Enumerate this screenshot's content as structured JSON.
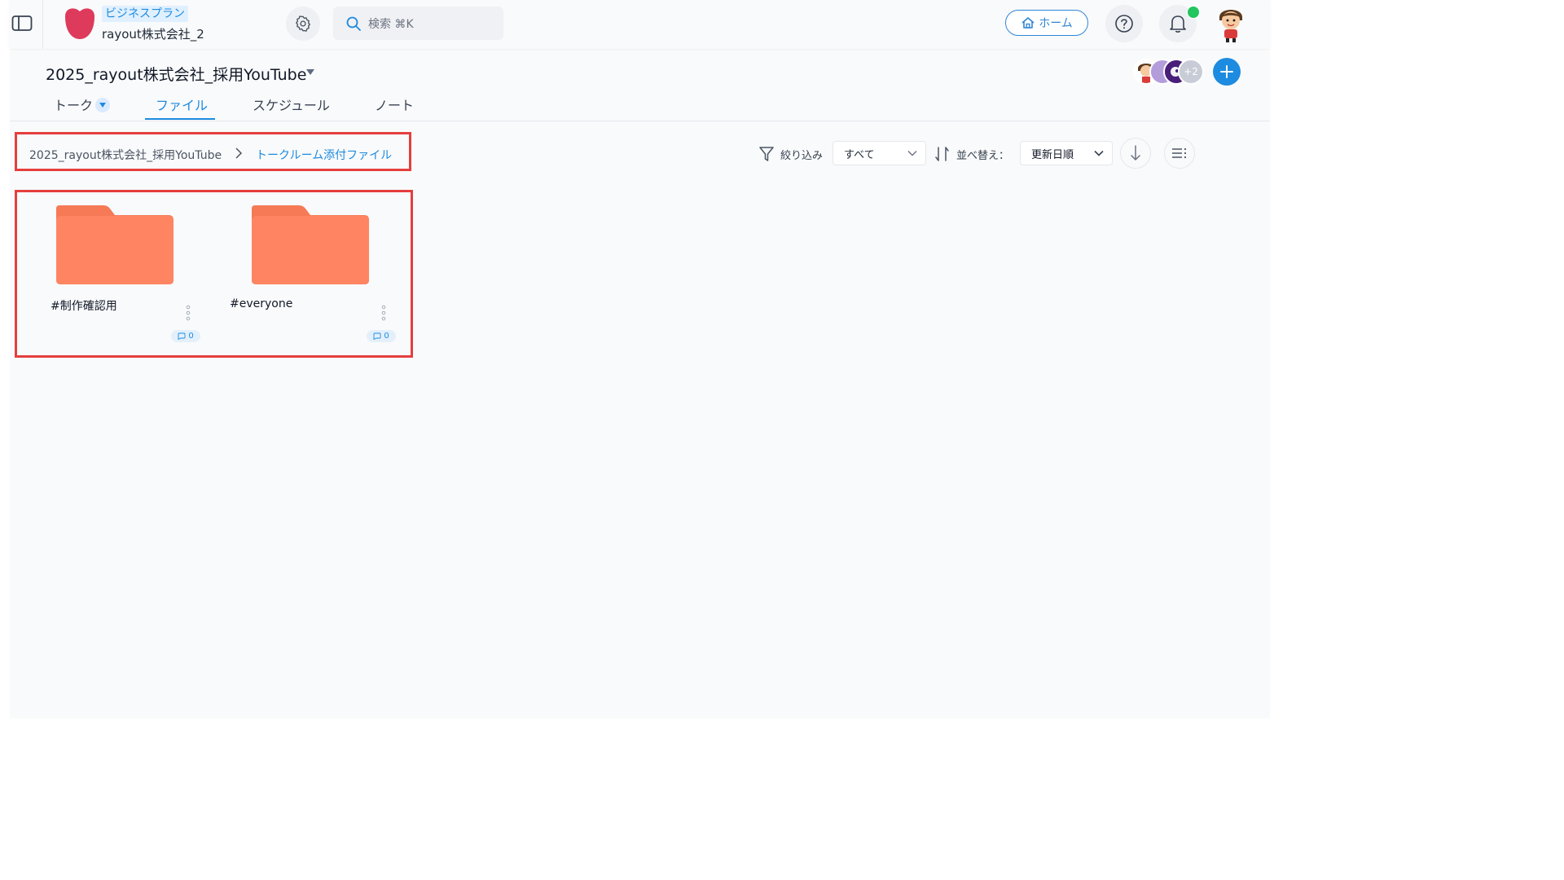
{
  "header": {
    "plan_badge": "ビジネスプラン",
    "org_name": "rayout株式会社_2",
    "search_placeholder": "検索 ⌘K",
    "home_label": "ホーム"
  },
  "room": {
    "title": "2025_rayout株式会社_採用YouTube",
    "tabs": [
      {
        "label": "トーク"
      },
      {
        "label": "ファイル",
        "active": true
      },
      {
        "label": "スケジュール"
      },
      {
        "label": "ノート"
      }
    ],
    "members_more": "+2"
  },
  "breadcrumb": {
    "root": "2025_rayout株式会社_採用YouTube",
    "current": "トークルーム添付ファイル"
  },
  "toolbar": {
    "filter_label": "絞り込み",
    "filter_value": "すべて",
    "sort_label": "並べ替え：",
    "sort_value": "更新日順"
  },
  "folders": [
    {
      "name": "#制作確認用",
      "count": "0"
    },
    {
      "name": "#everyone",
      "count": "0"
    }
  ],
  "colors": {
    "accent": "#1d8be0",
    "folder": "#ff8562",
    "highlight_border": "#e53e3e",
    "notification": "#22c55e"
  }
}
